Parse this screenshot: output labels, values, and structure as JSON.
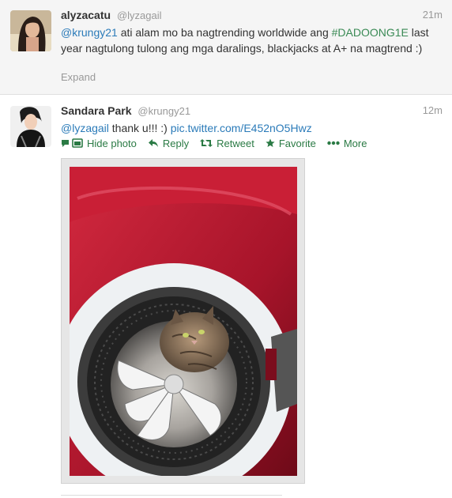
{
  "tweets": [
    {
      "fullname": "alyzacatu",
      "username": "@lyzagail",
      "time": "21m",
      "text_parts": [
        "@krungy21",
        " ati alam mo ba nagtrending worldwide ang ",
        "#DADOONG1E",
        " last year nagtulong tulong ang mga daralings, blackjacks at A+ na magtrend :)"
      ],
      "expand_label": "Expand"
    },
    {
      "fullname": "Sandara Park",
      "username": "@krungy21",
      "time": "12m",
      "text_parts": [
        "@lyzagail",
        " thank u!!! :) ",
        "pic.twitter.com/E452nO5Hwz"
      ],
      "actions": {
        "hide_photo": "Hide photo",
        "reply": "Reply",
        "retweet": "Retweet",
        "favorite": "Favorite",
        "more": "More"
      }
    }
  ],
  "colors": {
    "link_green": "#3a8a55",
    "action_green": "#2a7a44",
    "muted": "#999999",
    "washer_red": "#b0182c"
  }
}
